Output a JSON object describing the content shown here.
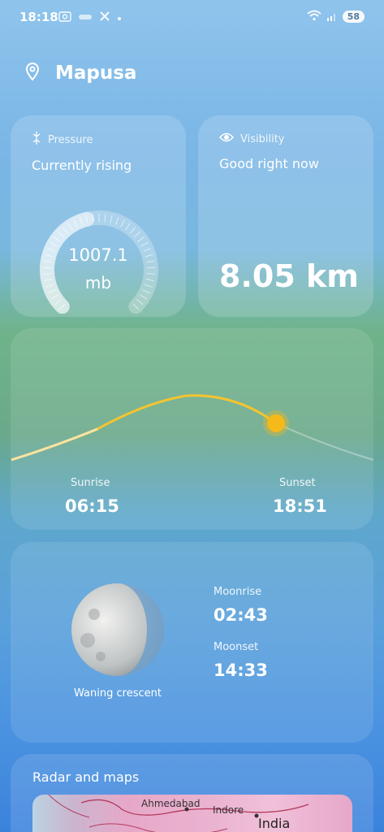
{
  "status_bar": {
    "time": "18:18",
    "left_icons": [
      "screenshot-icon",
      "snap-icon",
      "x-icon",
      "dot-icon"
    ],
    "right_icons": [
      "wifi-icon",
      "signal-icon"
    ],
    "battery": "58"
  },
  "location": {
    "icon": "location-pin-icon",
    "name": "Mapusa"
  },
  "pressure": {
    "label": "Pressure",
    "icon": "pressure-icon",
    "status": "Currently rising",
    "value": "1007.1",
    "unit": "mb",
    "gauge_fraction": 0.45
  },
  "visibility": {
    "label": "Visibility",
    "icon": "eye-icon",
    "status": "Good right now",
    "value": "8.05 km"
  },
  "sun": {
    "sunrise_label": "Sunrise",
    "sunrise_time": "06:15",
    "sunset_label": "Sunset",
    "sunset_time": "18:51"
  },
  "moon": {
    "phase": "Waning crescent",
    "moonrise_label": "Moonrise",
    "moonrise_time": "02:43",
    "moonset_label": "Moonset",
    "moonset_time": "14:33"
  },
  "radar": {
    "title": "Radar and maps",
    "cities": [
      "Ahmedabad",
      "Indore"
    ],
    "country": "India"
  },
  "colors": {
    "sun_arc": "#f4c430",
    "sun_dot": "#f6b91a"
  }
}
